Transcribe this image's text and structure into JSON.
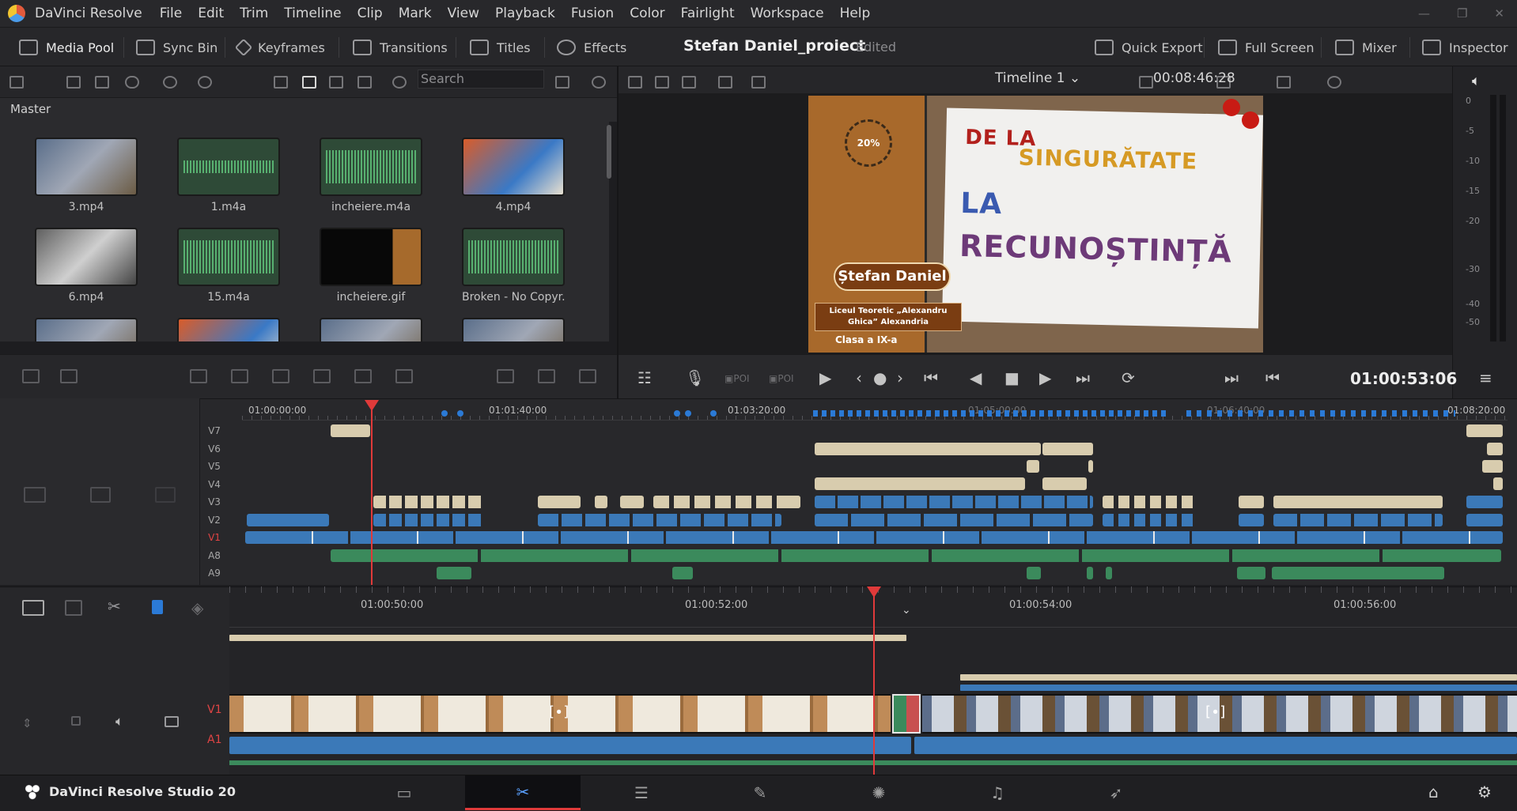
{
  "menu": {
    "app_name": "DaVinci Resolve",
    "items": [
      "File",
      "Edit",
      "Trim",
      "Timeline",
      "Clip",
      "Mark",
      "View",
      "Playback",
      "Fusion",
      "Color",
      "Fairlight",
      "Workspace",
      "Help"
    ]
  },
  "toolbar": {
    "media_pool": "Media Pool",
    "sync_bin": "Sync Bin",
    "keyframes": "Keyframes",
    "transitions": "Transitions",
    "titles": "Titles",
    "effects": "Effects",
    "project_title": "Stefan Daniel_proiect",
    "project_status": "Edited",
    "quick_export": "Quick Export",
    "full_screen": "Full Screen",
    "mixer": "Mixer",
    "inspector": "Inspector"
  },
  "media_pool": {
    "search_placeholder": "Search",
    "bin": "Master",
    "clips": [
      {
        "name": "3.mp4",
        "kind": "video"
      },
      {
        "name": "1.m4a",
        "kind": "audio-thin"
      },
      {
        "name": "incheiere.m4a",
        "kind": "audio"
      },
      {
        "name": "4.mp4",
        "kind": "video2"
      },
      {
        "name": "6.mp4",
        "kind": "bw"
      },
      {
        "name": "15.m4a",
        "kind": "audio"
      },
      {
        "name": "incheiere.gif",
        "kind": "dark"
      },
      {
        "name": "Broken - No Copyr...",
        "kind": "audio"
      }
    ]
  },
  "viewer": {
    "timeline_name": "Timeline 1",
    "duration_tc": "00:08:46:28",
    "frame": {
      "logo_text": "20%",
      "line1": "DE LA",
      "line2": "SINGURĂTATE",
      "line3": "LA",
      "line4": "RECUNOȘTINȚĂ",
      "lower_third_name": "Ștefan Daniel",
      "school": "Liceul Teoretic „Alexandru Ghica” Alexandria",
      "class": "Clasa a IX-a"
    },
    "meter_labels": [
      "0",
      "-5",
      "-10",
      "-15",
      "-20",
      "-30",
      "-40",
      "-50"
    ]
  },
  "transport": {
    "timecode": "01:00:53:06"
  },
  "upper_timeline": {
    "ruler_labels": [
      "01:00:00:00",
      "01:01:40:00",
      "01:03:20:00",
      "01:05:00:00",
      "01:06:40:00",
      "01:08:20:00"
    ],
    "tracks": [
      "V7",
      "V6",
      "V5",
      "V4",
      "V3",
      "V2",
      "V1",
      "A8",
      "A9"
    ]
  },
  "lower_timeline": {
    "ruler_labels": [
      "01:00:50:00",
      "01:00:52:00",
      "01:00:54:00",
      "01:00:56:00"
    ],
    "v1_label": "V1",
    "a1_label": "A1"
  },
  "page_nav": {
    "brand": "DaVinci Resolve Studio 20",
    "pages": [
      {
        "name": "media",
        "glyph": "▭"
      },
      {
        "name": "cut",
        "glyph": "✂"
      },
      {
        "name": "edit",
        "glyph": "☰"
      },
      {
        "name": "fusion",
        "glyph": "✎"
      },
      {
        "name": "color",
        "glyph": "✺"
      },
      {
        "name": "fairlight",
        "glyph": "♫"
      },
      {
        "name": "deliver",
        "glyph": "➶"
      }
    ],
    "active_page": "cut"
  },
  "colors": {
    "accent_red": "#e03a3a",
    "clip_blue": "#3b79b8",
    "clip_tan": "#d8ccae",
    "clip_green": "#3b8a5c",
    "active_blue": "#5aa0ff"
  }
}
